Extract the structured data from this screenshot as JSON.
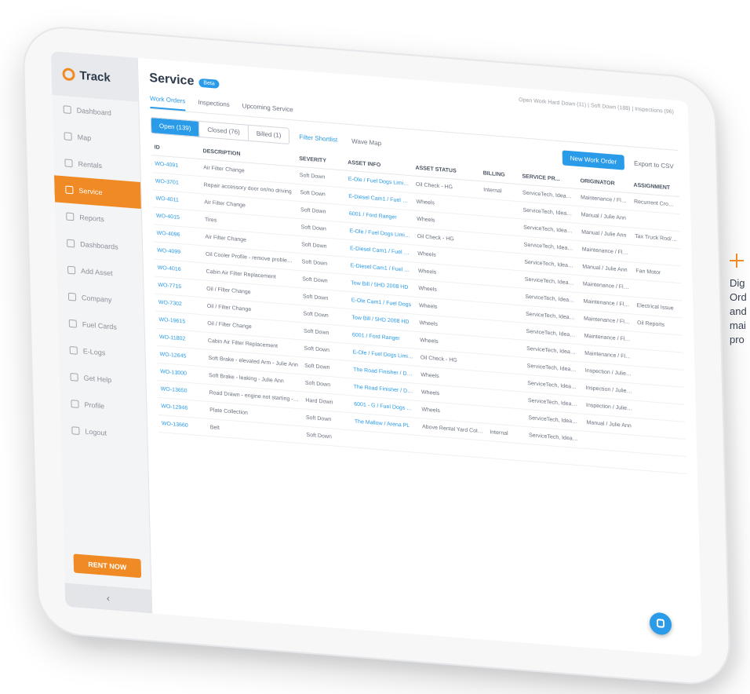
{
  "sidebar": {
    "logo": "Track",
    "items": [
      {
        "label": "Dashboard"
      },
      {
        "label": "Map"
      },
      {
        "label": "Rentals"
      },
      {
        "label": "Service",
        "active": true
      },
      {
        "label": "Reports"
      },
      {
        "label": "Dashboards"
      },
      {
        "label": "Add Asset"
      },
      {
        "label": "Company"
      },
      {
        "label": "Fuel Cards"
      },
      {
        "label": "E-Logs"
      },
      {
        "label": "Get Help"
      },
      {
        "label": "Profile"
      },
      {
        "label": "Logout"
      }
    ],
    "rent_button": "RENT NOW",
    "collapse_glyph": "‹"
  },
  "header": {
    "title": "Service",
    "badge": "Beta",
    "stats": "Open Work Hard Down (11) | Soft Down (188) | Inspections (96)"
  },
  "subtabs": [
    "Work Orders",
    "Inspections",
    "Upcoming Service"
  ],
  "filters": {
    "segments": [
      "Open (139)",
      "Closed (76)",
      "Billed (1)"
    ],
    "filter_link": "Filter Shortlist",
    "second_link": "Wave Map",
    "primary_button": "New Work Order",
    "export_button": "Export to CSV"
  },
  "table": {
    "columns": [
      "ID",
      "DESCRIPTION",
      "SEVERITY",
      "ASSET INFO",
      "ASSET STATUS",
      "BILLING",
      "SERVICE PR...",
      "ORIGINATOR",
      "ASSIGNMENT"
    ],
    "rows": [
      [
        "WO-4091",
        "Air Filter Change",
        "Soft Down",
        "E-Ole / Fuel Dogs Limited",
        "Oil Check - HG",
        "Internal",
        "ServiceTech, Ideas Branch",
        "Maintenance / Flexon",
        "Recurrent Cronable"
      ],
      [
        "WO-3701",
        "Repair accessory door on/no driving",
        "Soft Down",
        "E-Diesel Cam1 / Fuel Dogs",
        "Wheels",
        "",
        "ServiceTech, Ideas Branch",
        "Manual / Julie Ann",
        ""
      ],
      [
        "WO-4011",
        "Air Filter Change",
        "Soft Down",
        "6001 / Ford Ranger",
        "Wheels",
        "",
        "ServiceTech, Ideas Branch",
        "Manual / Julie Ann",
        "Tax Truck Rod/Chain"
      ],
      [
        "WO-4015",
        "Tires",
        "Soft Down",
        "E-Ole / Fuel Dogs Limited",
        "Oil Check - HG",
        "",
        "ServiceTech, Ideas Branch",
        "Maintenance / Flexon",
        ""
      ],
      [
        "WO-4096",
        "Air Filter Change",
        "Soft Down",
        "E-Diesel Cam1 / Fuel Dogs",
        "Wheels",
        "",
        "ServiceTech, Ideas Branch",
        "Manual / Julie Ann",
        "Fan Motor"
      ],
      [
        "WO-4099",
        "Oil Cooler Profile - remove problem on line/tool",
        "Soft Down",
        "E-Diesel Cam1 / Fuel Dogs",
        "Wheels",
        "",
        "ServiceTech, Ideas Branch",
        "Maintenance / Flexon",
        ""
      ],
      [
        "WO-4016",
        "Cabin Air Filter Replacement",
        "Soft Down",
        "Tow Bill / 5HD 2008 HD",
        "Wheels",
        "",
        "ServiceTech, Ideas Branch",
        "Maintenance / Flexon",
        "Electrical Issue"
      ],
      [
        "WO-7715",
        "Oil / Filter Change",
        "Soft Down",
        "E-Ole Cam1 / Fuel Dogs",
        "Wheels",
        "",
        "ServiceTech, Ideas Branch",
        "Maintenance / Flexon",
        "Oil Reports"
      ],
      [
        "WO-7302",
        "Oil / Filter Change",
        "Soft Down",
        "Tow Bill / 5HD 2008 HD",
        "Wheels",
        "",
        "ServiceTech, Ideas Branch",
        "Maintenance / Flexon",
        ""
      ],
      [
        "WO-19615",
        "Oil / Filter Change",
        "Soft Down",
        "6001 / Ford Ranger",
        "Wheels",
        "",
        "ServiceTech, Ideas Branch",
        "Maintenance / Flexon",
        ""
      ],
      [
        "WO-11802",
        "Cabin Air Filter Replacement",
        "Soft Down",
        "E-Ole / Fuel Dogs Limited",
        "Oil Check - HG",
        "",
        "ServiceTech, Ideas Branch",
        "Inspection / Julie Ann",
        ""
      ],
      [
        "WO-12645",
        "Soft Brake - elevated Arm - Julie Ann",
        "Soft Down",
        "The Road Finisher / Deluxe Potential",
        "Wheels",
        "",
        "ServiceTech, Ideas Branch",
        "Inspection / Julie Ann",
        ""
      ],
      [
        "WO-13000",
        "Soft Brake - leaking - Julie Ann",
        "Soft Down",
        "The Road Finisher / Deluxe Potential",
        "Wheels",
        "",
        "ServiceTech, Ideas Branch",
        "Inspection / Julie Ann",
        ""
      ],
      [
        "WO-13650",
        "Road Drawn - engine not starting - Julie Ann",
        "Hard Down",
        "6001 - G / Fuel Dogs Channel Limit",
        "Wheels",
        "",
        "ServiceTech, Ideas Branch",
        "Manual / Julie Ann",
        ""
      ],
      [
        "WO-12946",
        "Plate Collection",
        "Soft Down",
        "The Mallow / Arena PL",
        "Above Rental Yard Colorado",
        "Internal",
        "ServiceTech, Ideas Branch",
        "",
        ""
      ],
      [
        "WO-13660",
        "Belt",
        "Soft Down",
        "",
        "",
        "",
        "",
        "",
        ""
      ]
    ]
  },
  "caption": {
    "line1": "Dig",
    "line2": "Ord",
    "line3": "and",
    "line4": "mai",
    "line5": "pro"
  },
  "colors": {
    "accent_orange": "#f08a24",
    "accent_blue": "#2a9be8"
  }
}
